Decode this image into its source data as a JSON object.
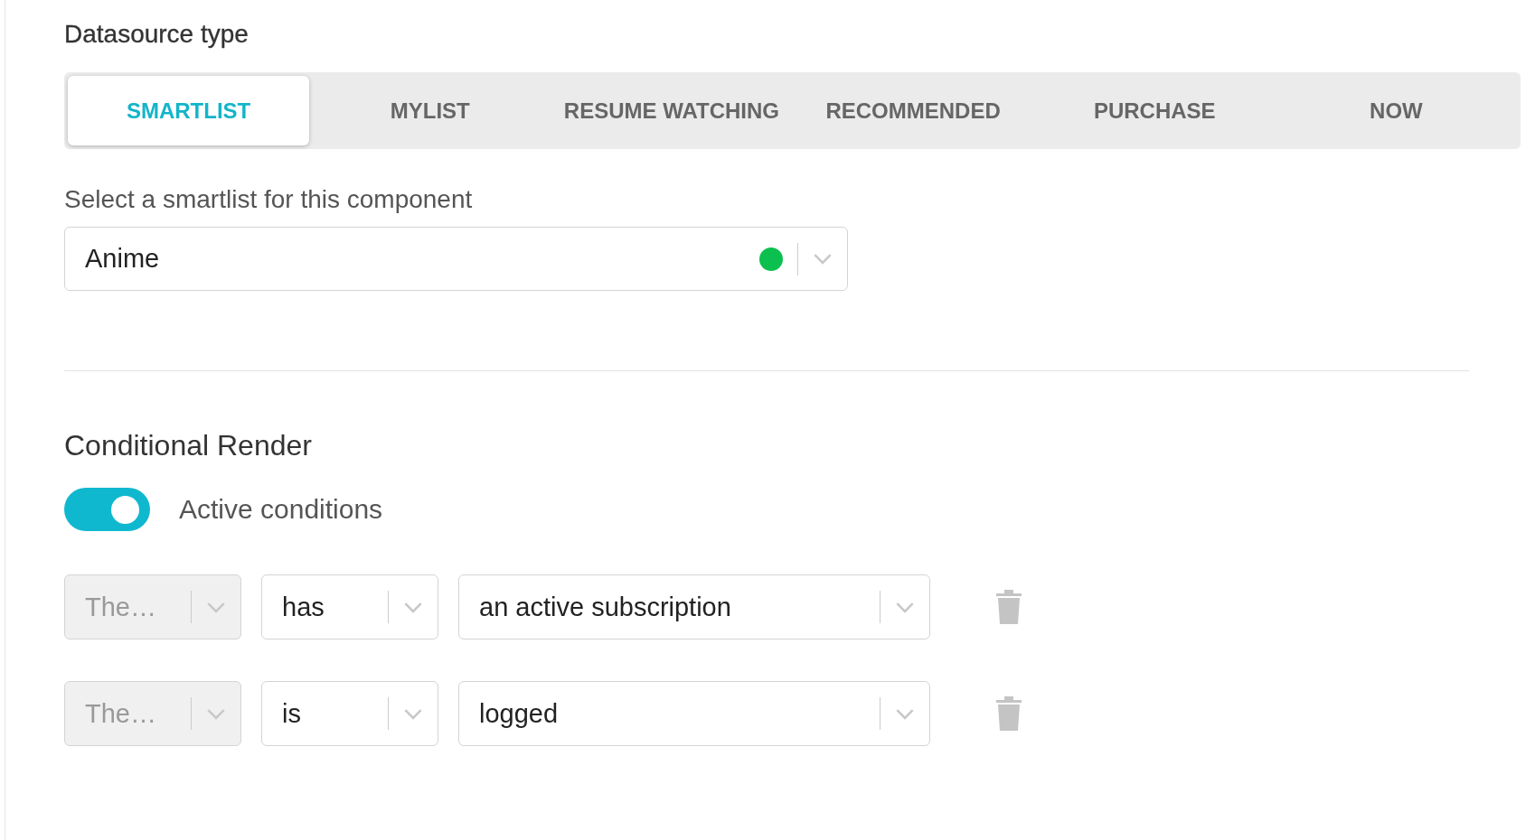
{
  "datasource": {
    "title": "Datasource type",
    "tabs": [
      {
        "label": "SMARTLIST",
        "selected": true
      },
      {
        "label": "MYLIST",
        "selected": false
      },
      {
        "label": "RESUME WATCHING",
        "selected": false
      },
      {
        "label": "RECOMMENDED",
        "selected": false
      },
      {
        "label": "PURCHASE",
        "selected": false
      },
      {
        "label": "NOW",
        "selected": false
      }
    ],
    "smartlist_label": "Select a smartlist for this component",
    "smartlist_select": {
      "value": "Anime"
    }
  },
  "conditional_render": {
    "title": "Conditional Render",
    "toggle": {
      "label": "Active conditions",
      "on": true
    },
    "conditions": [
      {
        "subject": {
          "value": "The…",
          "disabled": true
        },
        "operator": {
          "value": "has",
          "disabled": false
        },
        "target": {
          "value": "an active subscription",
          "disabled": false
        }
      },
      {
        "subject": {
          "value": "The…",
          "disabled": true
        },
        "operator": {
          "value": "is",
          "disabled": false
        },
        "target": {
          "value": "logged",
          "disabled": false
        }
      }
    ]
  }
}
